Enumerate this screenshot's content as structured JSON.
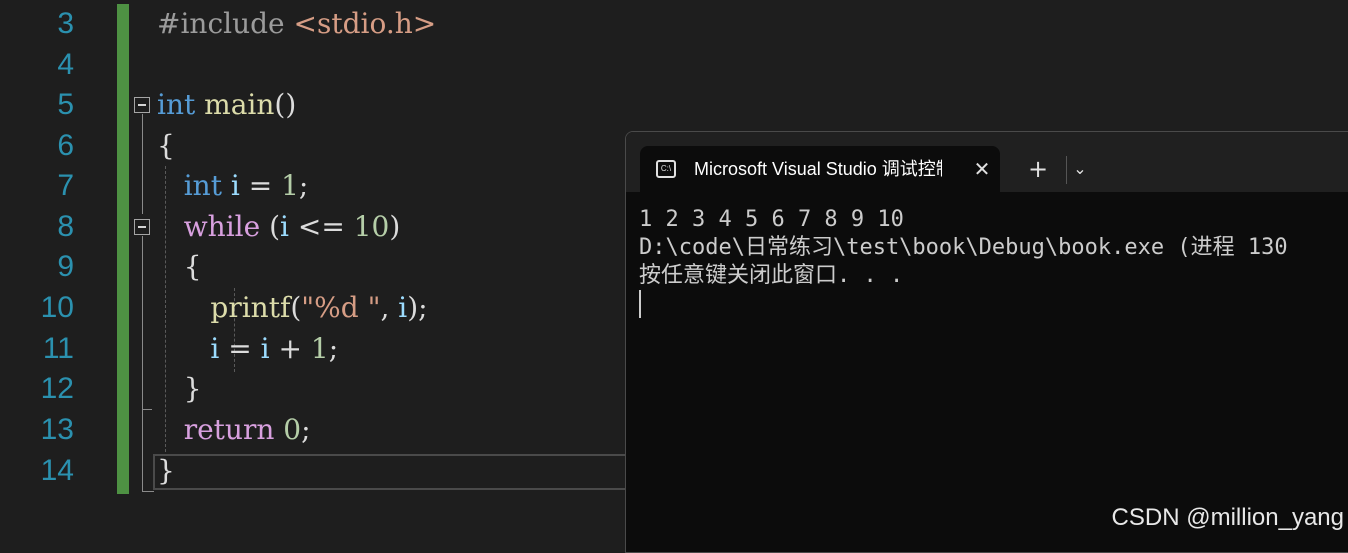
{
  "editor": {
    "line_numbers": [
      "3",
      "4",
      "5",
      "6",
      "7",
      "8",
      "9",
      "10",
      "11",
      "12",
      "13",
      "14"
    ],
    "lines": {
      "l3": {
        "pre": "#include ",
        "inc": "<stdio.h>"
      },
      "l5": {
        "kw": "int",
        "sp": " ",
        "fn": "main",
        "rest": "()"
      },
      "l6": {
        "rest": "{"
      },
      "l7": {
        "indent": "   ",
        "kw": "int",
        "sp": " ",
        "var": "i",
        "mid": " = ",
        "num": "1",
        "end": ";"
      },
      "l8": {
        "indent": "   ",
        "ctl": "while",
        "mid": " (",
        "var": "i",
        "op": " <= ",
        "num": "10",
        "end": ")"
      },
      "l9": {
        "indent": "   ",
        "rest": "{"
      },
      "l10": {
        "indent": "      ",
        "fn": "printf",
        "open": "(",
        "str": "\"%d \"",
        "mid": ", ",
        "var": "i",
        "end": ");"
      },
      "l11": {
        "indent": "      ",
        "var": "i",
        "mid": " = ",
        "var2": "i",
        "op": " + ",
        "num": "1",
        "end": ";"
      },
      "l12": {
        "indent": "   ",
        "rest": "}"
      },
      "l13": {
        "indent": "   ",
        "ctl": "return",
        "sp": " ",
        "num": "0",
        "end": ";"
      },
      "l14": {
        "rest": "}"
      }
    }
  },
  "terminal": {
    "tab_icon": "C:\\",
    "tab_title": "Microsoft Visual Studio 调试控制台",
    "close_glyph": "✕",
    "new_tab_glyph": "+",
    "dropdown_glyph": "⌄",
    "output": [
      "1 2 3 4 5 6 7 8 9 10",
      "D:\\code\\日常练习\\test\\book\\Debug\\book.exe (进程 130",
      "按任意键关闭此窗口. . ."
    ]
  },
  "watermark": "CSDN @million_yang",
  "colors": {
    "keyword": "#569cd6",
    "control": "#d8a0df",
    "function": "#dcdcaa",
    "variable": "#9cdcfe",
    "number": "#b5cea8",
    "string": "#d69d85",
    "line_number": "#2b91af",
    "change_bar": "#57a64a"
  }
}
